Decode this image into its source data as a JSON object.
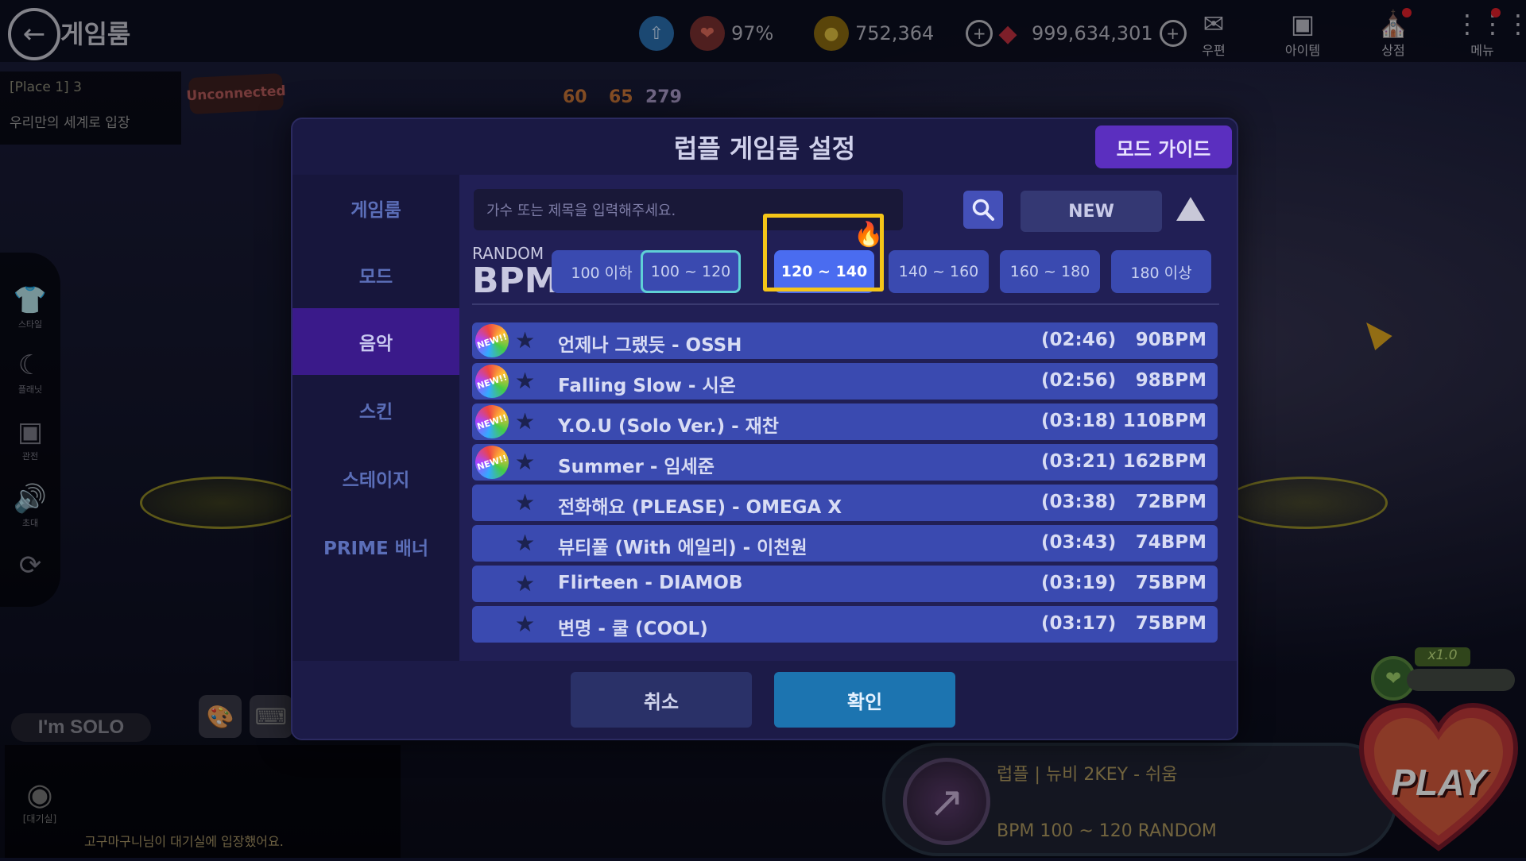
{
  "topbar": {
    "title": "게임룸",
    "stamina_percent": "97%",
    "gold": "752,364",
    "gems": "999,634,301",
    "menu": [
      {
        "label": "우편",
        "icon": "mail-icon"
      },
      {
        "label": "아이템",
        "icon": "briefcase-icon"
      },
      {
        "label": "상점",
        "icon": "shop-icon"
      },
      {
        "label": "메뉴",
        "icon": "grid-menu-icon"
      }
    ]
  },
  "place": {
    "line1": "[Place 1] 3",
    "line2": "우리만의 세계로 입장"
  },
  "unconnected": "Unconnected",
  "level_badges": [
    "60",
    "65",
    "279"
  ],
  "left_tools": [
    "스타일",
    "플래닛",
    "관전",
    "초대"
  ],
  "solo_label": "I'm SOLO",
  "chat": {
    "lobby_label": "[대기실]",
    "message": "고구마구니님이 대기실에 입장했어요."
  },
  "modal": {
    "title": "럽플 게임룸 설정",
    "guide_button": "모드 가이드",
    "side_menu": [
      "게임룸",
      "모드",
      "음악",
      "스킨",
      "스테이지",
      "PRIME 배너"
    ],
    "active_side": 2,
    "search_placeholder": "가수 또는 제목을 입력해주세요.",
    "new_button": "NEW",
    "bpm_random_label": "RANDOM",
    "bpm_label": "BPM",
    "bpm_filters": [
      "100 이하",
      "100 ~ 120",
      "120 ~ 140",
      "140 ~ 160",
      "160 ~ 180",
      "180 이상"
    ],
    "bpm_selected": 2,
    "songs": [
      {
        "new": true,
        "name": "언제나 그랬듯 - OSSH",
        "duration": "(02:46)",
        "bpm": "90BPM"
      },
      {
        "new": true,
        "name": "Falling Slow - 시온",
        "duration": "(02:56)",
        "bpm": "98BPM"
      },
      {
        "new": true,
        "name": "Y.O.U (Solo Ver.) - 재찬",
        "duration": "(03:18)",
        "bpm": "110BPM"
      },
      {
        "new": true,
        "name": "Summer - 임세준",
        "duration": "(03:21)",
        "bpm": "162BPM"
      },
      {
        "new": false,
        "name": "전화해요 (PLEASE) - OMEGA X",
        "duration": "(03:38)",
        "bpm": "72BPM"
      },
      {
        "new": false,
        "name": "뷰티풀 (With 에일리) - 이천원",
        "duration": "(03:43)",
        "bpm": "74BPM"
      },
      {
        "new": false,
        "name": "Flirteen - DIAMOB",
        "duration": "(03:19)",
        "bpm": "75BPM"
      },
      {
        "new": false,
        "name": "변명 - 쿨 (COOL)",
        "duration": "(03:17)",
        "bpm": "75BPM"
      }
    ],
    "new_badge_text": "NEW!!",
    "cancel_button": "취소",
    "confirm_button": "확인"
  },
  "current_song": {
    "line1": "럽플 | 뉴비 2KEY - 쉬움",
    "line2": "BPM 100 ~ 120 RANDOM"
  },
  "multiplier": "x1.0",
  "play_label": "PLAY",
  "colors": {
    "accent_purple": "#5b2fbf",
    "bpm_button": "#3a4ab0",
    "bpm_selected": "#4a6cf0",
    "highlight_frame": "#f5c518",
    "confirm": "#1c74b0"
  }
}
